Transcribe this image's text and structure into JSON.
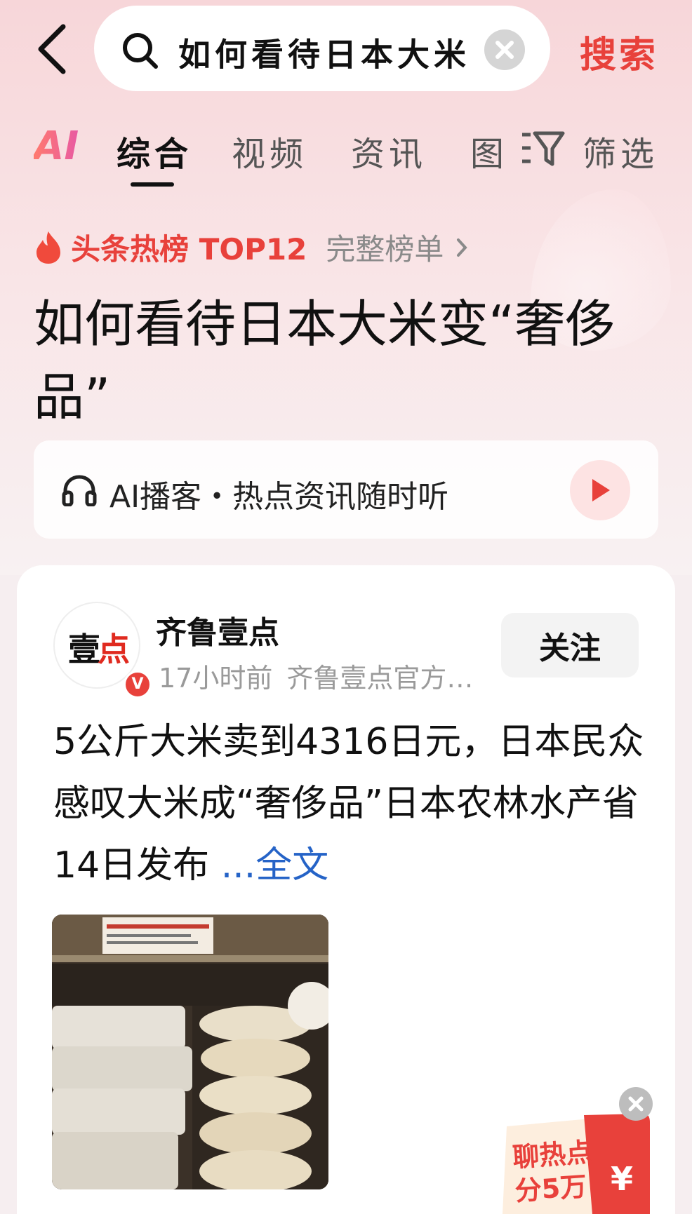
{
  "search": {
    "query": "如何看待日本大米",
    "submit_label": "搜索"
  },
  "tabs": {
    "ai_label": "AI",
    "items": [
      "综合",
      "视频",
      "资讯",
      "图"
    ],
    "filter_label": "筛选"
  },
  "hotlist": {
    "label": "头条热榜 TOP12",
    "full_list_label": "完整榜单"
  },
  "headline": "如何看待日本大米变“奢侈品”",
  "podcast": {
    "label": "AI播客・热点资讯随时听"
  },
  "article": {
    "author": "齐鲁壹点",
    "avatar_text_a": "壹",
    "avatar_text_b": "点",
    "verified_badge": "V",
    "time": "17小时前",
    "source": "齐鲁壹点官方…",
    "follow_label": "关注",
    "body": "5公斤大米卖到4316日元，日本民众感叹大米成“奢侈品”日本农林水产省14日发布",
    "more_label": " ...全文"
  },
  "promo": {
    "line1": "聊热点",
    "line2": "分5万",
    "yen": "¥"
  },
  "colors": {
    "accent_red": "#e8413b",
    "link_blue": "#2563c7"
  }
}
